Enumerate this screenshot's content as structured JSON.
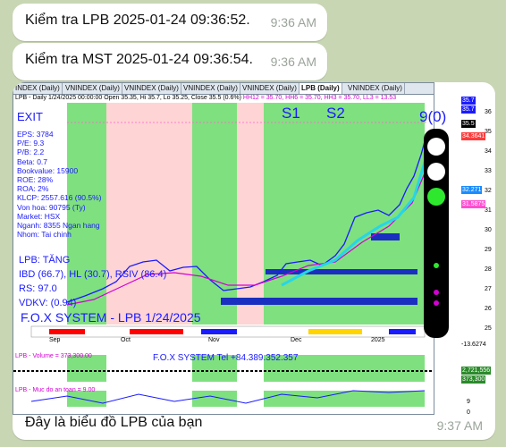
{
  "messages": [
    {
      "text": "Kiểm tra LPB 2025-01-24 09:36:52.",
      "time": "9:36 AM"
    },
    {
      "text": "Kiểm tra MST 2025-01-24 09:36:54.",
      "time": "9:36 AM"
    }
  ],
  "chart_message": {
    "caption": "Đây là biểu đồ LPB của bạn",
    "time": "9:37 AM"
  },
  "chart": {
    "tabs": [
      "INDEX (Daily)",
      "VNINDEX (Daily)",
      "VNINDEX (Daily)",
      "VNINDEX (Daily)",
      "VNINDEX (Daily)",
      "LPB (Daily)",
      "VNINDEX (Daily)"
    ],
    "active_tab": 5,
    "info_line": "LPB - Daily 1/24/2025 00:00:00 Open 35.35, Hi 35.7, Lo 35.25, Close 35.5 (0.6%)",
    "info_line_hh": "HH12 = 35.70, HH6 = 35.70, HH3 = 35.70, LL3 = 13.53",
    "exit_label": "EXIT",
    "s1_label": "S1",
    "s2_label": "S2",
    "signal_label": "9(0)",
    "stats": [
      "EPS: 3784",
      "P/E: 9.3",
      "P/B: 2.2",
      "Beta: 0.7",
      "Bookvalue: 15900",
      "ROE: 28%",
      "ROA: 2%",
      "KLCP: 2557.616 (90.5%)",
      "Von hoa: 90795 (Ty)",
      "Market: HSX",
      "Nganh: 8355 Ngan hang",
      "Nhom: Tai chinh"
    ],
    "status": "LPB: TĂNG",
    "ibd_line": "IBD (66.7), HL (30.7), RSIV (86.4)",
    "rs_line": "RS: 97.0",
    "vdkv_line": "VDKV: (0.94)",
    "system_title": "F.O.X SYSTEM - LPB 1/24/2025",
    "x_labels": [
      "Sep",
      "Oct",
      "Nov",
      "Dec",
      "2025"
    ],
    "price_ticks": [
      "36",
      "35",
      "34",
      "33",
      "32",
      "31",
      "30",
      "29",
      "28",
      "27",
      "26",
      "25"
    ],
    "price_tags": [
      {
        "text": "35.7",
        "color": "#1a1aff"
      },
      {
        "text": "35.7",
        "color": "#1a1aff"
      },
      {
        "text": "35.5",
        "color": "#000000"
      },
      {
        "text": "34.3641",
        "color": "#ff3b3b"
      },
      {
        "text": "32.271",
        "color": "#1a8cff"
      },
      {
        "text": "31.5875",
        "color": "#ff4fd0"
      }
    ],
    "volume_label": "LPB - Volume = 373,300.00",
    "volume_title": "F.O.X SYSTEM Tel +84.389.352.357",
    "volume_tags": [
      "2,721,556",
      "373,300"
    ],
    "safety_label": "LPB - Muc do an toan = 9.00",
    "safety_ticks": [
      "9",
      "0"
    ],
    "mid_value": "-13.6274",
    "colors": {
      "green_zone": "#7fe07f",
      "pink_zone": "#ffd4d4",
      "accent_blue": "#1a1aff",
      "magenta": "#d400d4"
    }
  }
}
